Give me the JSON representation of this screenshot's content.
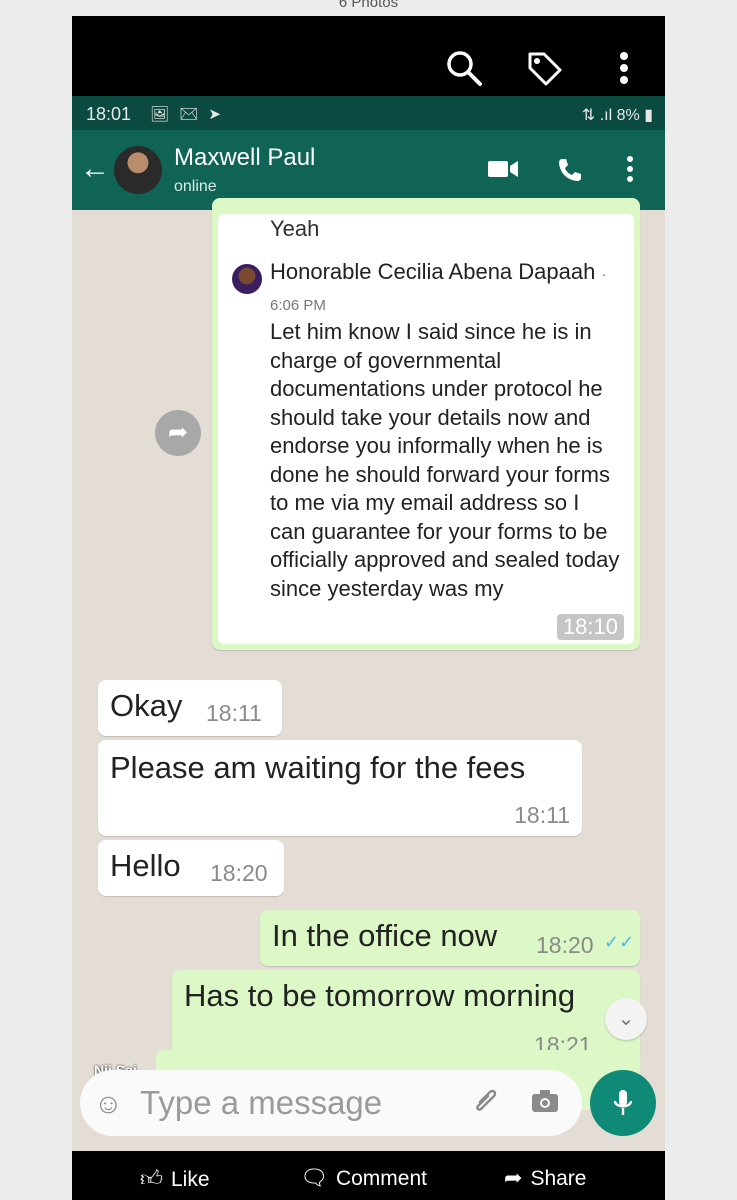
{
  "caption": "6 Photos",
  "photo_viewer": {
    "search_icon": "search-icon",
    "tag_icon": "tag-icon",
    "more_icon": "more-vertical-icon"
  },
  "status": {
    "time": "18:01",
    "battery": "8%"
  },
  "header": {
    "name": "Maxwell Paul",
    "status": "online"
  },
  "quoted": {
    "preceding_text": "Yeah",
    "author": "Honorable Cecilia Abena Dapaah",
    "time": "· 6:06 PM",
    "text": "Let him know I said since he is in charge of governmental documentations under protocol he should take your details now and endorse you informally when he is done he should forward your forms to me via my email address so I can guarantee for your forms to be officially approved and sealed today since yesterday was my",
    "stamp": "18:10"
  },
  "messages": [
    {
      "text": "Okay",
      "time": "18:11",
      "dir": "in"
    },
    {
      "text": "Please am waiting for the fees",
      "time": "18:11",
      "dir": "in"
    },
    {
      "text": "Hello",
      "time": "18:20",
      "dir": "in"
    },
    {
      "text": "In the office now",
      "time": "18:20",
      "dir": "out"
    },
    {
      "text": "Has to be tomorrow morning",
      "time": "18:21",
      "dir": "out"
    }
  ],
  "input": {
    "placeholder": "Type a message",
    "watermark": "Nii Sai"
  },
  "actions": {
    "like": "Like",
    "comment": "Comment",
    "share": "Share"
  },
  "colors": {
    "header": "#0f6456",
    "outgoing": "#dcf8c6",
    "incoming": "#ffffff",
    "chat_bg": "#e4ddd6"
  }
}
